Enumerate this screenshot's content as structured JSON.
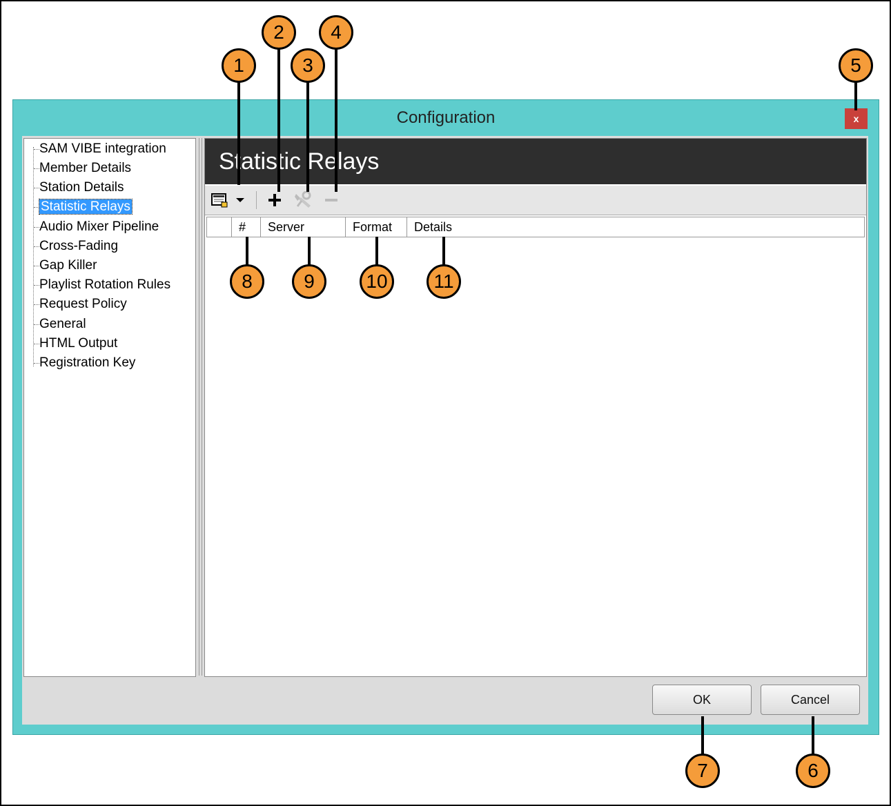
{
  "window": {
    "title": "Configuration",
    "close_label": "x"
  },
  "tree": {
    "items": [
      {
        "label": "SAM VIBE integration"
      },
      {
        "label": "Member Details"
      },
      {
        "label": "Station Details"
      },
      {
        "label": "Statistic Relays",
        "selected": true
      },
      {
        "label": "Audio Mixer Pipeline"
      },
      {
        "label": "Cross-Fading"
      },
      {
        "label": "Gap Killer"
      },
      {
        "label": "Playlist Rotation Rules"
      },
      {
        "label": "Request Policy"
      },
      {
        "label": "General"
      },
      {
        "label": "HTML Output"
      },
      {
        "label": "Registration Key"
      }
    ]
  },
  "panel": {
    "title": "Statistic Relays",
    "toolbar": {
      "icons": [
        "display-template-icon",
        "chevron-down-icon",
        "add-icon",
        "edit-icon",
        "remove-icon"
      ]
    },
    "columns": [
      "#",
      "Server",
      "Format",
      "Details"
    ]
  },
  "buttons": {
    "ok": "OK",
    "cancel": "Cancel"
  },
  "callouts": [
    "1",
    "2",
    "3",
    "4",
    "5",
    "6",
    "7",
    "8",
    "9",
    "10",
    "11"
  ],
  "colors": {
    "title_bar": "#5ecdcd",
    "header_bg": "#2e2e2e",
    "selection": "#3399ff",
    "close": "#c9413b",
    "callout": "#f59c3a"
  }
}
